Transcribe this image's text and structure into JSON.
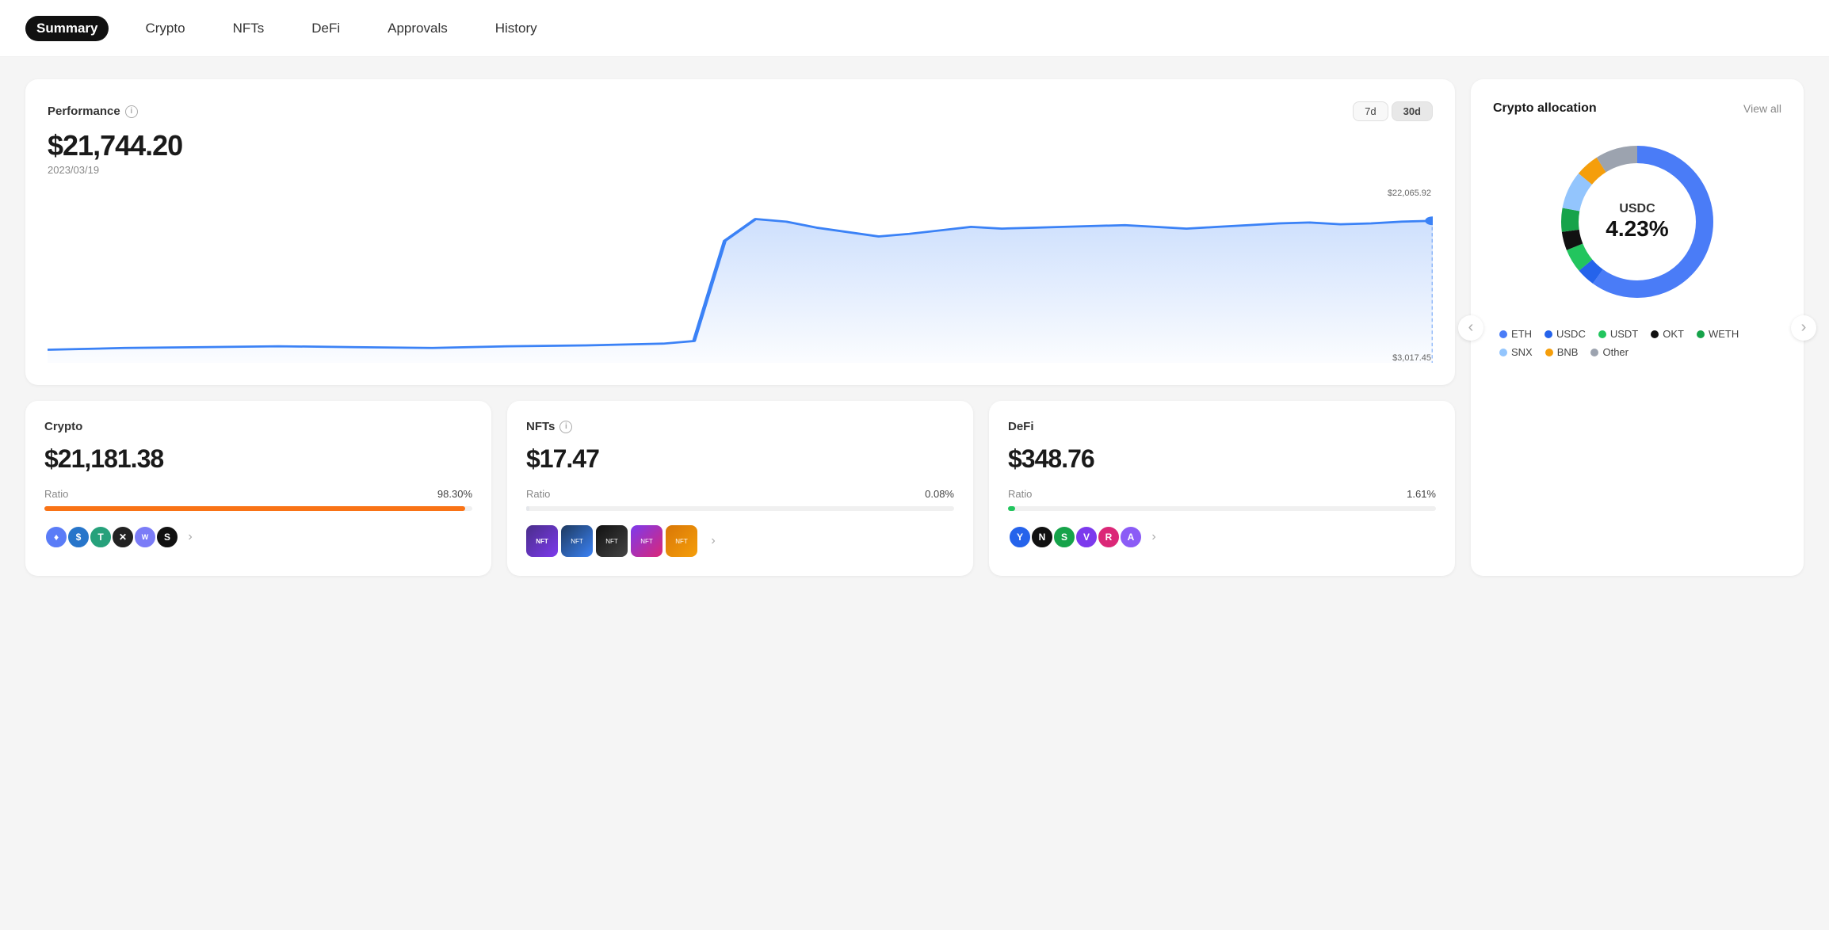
{
  "nav": {
    "items": [
      {
        "label": "Summary",
        "active": true
      },
      {
        "label": "Crypto",
        "active": false
      },
      {
        "label": "NFTs",
        "active": false
      },
      {
        "label": "DeFi",
        "active": false
      },
      {
        "label": "Approvals",
        "active": false
      },
      {
        "label": "History",
        "active": false
      }
    ]
  },
  "performance": {
    "title": "Performance",
    "amount": "$21,744.20",
    "date": "2023/03/19",
    "time_buttons": [
      "7d",
      "30d"
    ],
    "active_time": "30d",
    "chart_max": "$22,065.92",
    "chart_min": "$3,017.45"
  },
  "allocation": {
    "title": "Crypto allocation",
    "view_all": "View all",
    "center_label": "USDC",
    "center_pct": "4.23%",
    "legend": [
      {
        "label": "ETH",
        "color": "#4a7cf7"
      },
      {
        "label": "USDC",
        "color": "#2563eb"
      },
      {
        "label": "USDT",
        "color": "#22c55e"
      },
      {
        "label": "OKT",
        "color": "#111"
      },
      {
        "label": "WETH",
        "color": "#16a34a"
      },
      {
        "label": "SNX",
        "color": "#93c5fd"
      },
      {
        "label": "BNB",
        "color": "#f59e0b"
      },
      {
        "label": "Other",
        "color": "#9ca3af"
      }
    ]
  },
  "bottom_cards": {
    "crypto": {
      "title": "Crypto",
      "amount": "$21,181.38",
      "ratio_label": "Ratio",
      "ratio_pct": "98.30%",
      "bar_color": "#f97316",
      "bar_width": "98.3"
    },
    "nfts": {
      "title": "NFTs",
      "amount": "$17.47",
      "ratio_label": "Ratio",
      "ratio_pct": "0.08%",
      "bar_color": "#e5e7eb",
      "bar_width": "0.08"
    },
    "defi": {
      "title": "DeFi",
      "amount": "$348.76",
      "ratio_label": "Ratio",
      "ratio_pct": "1.61%",
      "bar_color": "#22c55e",
      "bar_width": "1.61"
    }
  }
}
